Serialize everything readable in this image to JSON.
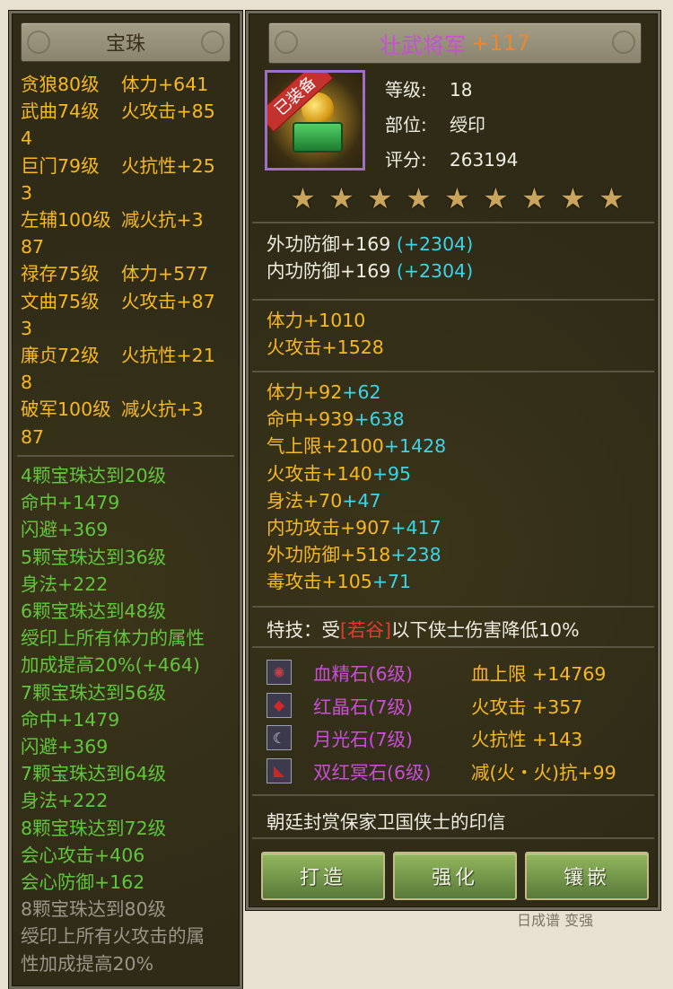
{
  "left": {
    "title": "宝珠",
    "stats": [
      [
        "贪狼80级",
        "体力+641"
      ],
      [
        "武曲74级",
        "火攻击+85"
      ],
      [
        "4",
        ""
      ],
      [
        "巨门79级",
        "火抗性+25"
      ],
      [
        "3",
        ""
      ],
      [
        "左辅100级",
        "减火抗+3"
      ],
      [
        "87",
        ""
      ],
      [
        "禄存75级",
        "体力+577"
      ],
      [
        "文曲75级",
        "火攻击+87"
      ],
      [
        "3",
        ""
      ],
      [
        "廉贞72级",
        "火抗性+21"
      ],
      [
        "8",
        ""
      ],
      [
        "破军100级",
        "减火抗+3"
      ],
      [
        "87",
        ""
      ]
    ],
    "bonuses": [
      {
        "text": "4颗宝珠达到20级",
        "tone": "green"
      },
      {
        "text": "命中+1479",
        "tone": "green"
      },
      {
        "text": "闪避+369",
        "tone": "green"
      },
      {
        "text": "5颗宝珠达到36级",
        "tone": "green"
      },
      {
        "text": "身法+222",
        "tone": "green"
      },
      {
        "text": "6颗宝珠达到48级",
        "tone": "green"
      },
      {
        "text": "绶印上所有体力的属性",
        "tone": "green"
      },
      {
        "text": "加成提高20%(+464)",
        "tone": "green"
      },
      {
        "text": "7颗宝珠达到56级",
        "tone": "green"
      },
      {
        "text": "命中+1479",
        "tone": "green"
      },
      {
        "text": "闪避+369",
        "tone": "green"
      },
      {
        "text": "7颗宝珠达到64级",
        "tone": "green"
      },
      {
        "text": "身法+222",
        "tone": "green"
      },
      {
        "text": "8颗宝珠达到72级",
        "tone": "green"
      },
      {
        "text": "会心攻击+406",
        "tone": "green"
      },
      {
        "text": "会心防御+162",
        "tone": "green"
      },
      {
        "text": "8颗宝珠达到80级",
        "tone": "gray"
      },
      {
        "text": "绶印上所有火攻击的属",
        "tone": "gray"
      },
      {
        "text": "性加成提高20%",
        "tone": "gray"
      }
    ]
  },
  "item": {
    "name": "壮武将军",
    "plus": "+117",
    "badge": "已装备",
    "meta": [
      {
        "key": "等级:",
        "value": "18"
      },
      {
        "key": "部位:",
        "value": "绶印"
      },
      {
        "key": "评分:",
        "value": "263194"
      }
    ],
    "stars": 9,
    "defense": [
      {
        "base": "外功防御+169",
        "extra": "(+2304)"
      },
      {
        "base": "内功防御+169",
        "extra": "(+2304)"
      }
    ],
    "main_attrs": [
      "体力+1010",
      "火攻击+1528"
    ],
    "sub_attrs": [
      {
        "base": "体力+92",
        "extra": "+62"
      },
      {
        "base": "命中+939",
        "extra": "+638"
      },
      {
        "base": "气上限+2100",
        "extra": "+1428"
      },
      {
        "base": "火攻击+140",
        "extra": "+95"
      },
      {
        "base": "身法+70",
        "extra": "+47"
      },
      {
        "base": "内功攻击+907",
        "extra": "+417"
      },
      {
        "base": "外功防御+518",
        "extra": "+238"
      },
      {
        "base": "毒攻击+105",
        "extra": "+71"
      }
    ],
    "special": {
      "prefix": "特技：受",
      "highlight": "[若谷]",
      "suffix": "以下侠士伤害降低10%"
    },
    "gems": [
      {
        "icon": "blood-essence-gem-icon",
        "glyph": "✺",
        "color": "#d33a44",
        "name": "血精石(6级)",
        "stat": "血上限 +14769"
      },
      {
        "icon": "red-crystal-gem-icon",
        "glyph": "◆",
        "color": "#d12a2a",
        "name": "红晶石(7级)",
        "stat": "火攻击 +357"
      },
      {
        "icon": "moonlight-gem-icon",
        "glyph": "☾",
        "color": "#cfd6ea",
        "name": "月光石(7级)",
        "stat": "火抗性 +143"
      },
      {
        "icon": "twin-red-gem-icon",
        "glyph": "◣",
        "color": "#c22a2a",
        "name": "双红冥石(6级)",
        "stat": "减(火・火)抗+99"
      }
    ],
    "description": "朝廷封赏保家卫国侠士的印信"
  },
  "buttons": {
    "forge": "打造",
    "enhance": "强化",
    "inlay": "镶嵌"
  },
  "background": {
    "peek_text": "日成谱 变强"
  }
}
